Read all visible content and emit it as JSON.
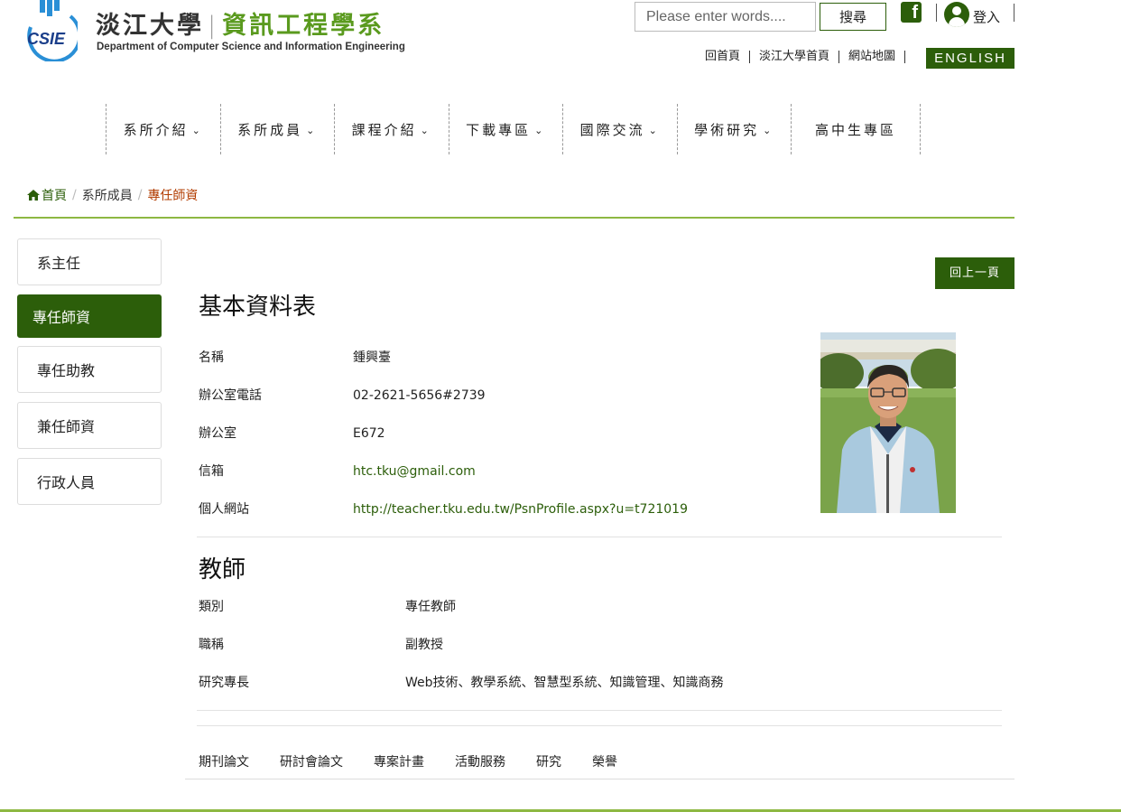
{
  "header": {
    "brand_university": "淡江大學",
    "brand_department": "資訊工程學系",
    "brand_english": "Department of Computer Science and Information Engineering",
    "logo_text": "CSIE",
    "search_placeholder": "Please enter words....",
    "search_button": "搜尋",
    "facebook_icon": "facebook-icon",
    "login_label": "登入",
    "top_links": [
      "回首頁",
      "淡江大學首頁",
      "網站地圖"
    ],
    "english_button": "ENGLISH"
  },
  "nav": {
    "items": [
      {
        "label": "系所介紹",
        "chevron": "⌄"
      },
      {
        "label": "系所成員",
        "chevron": "⌄"
      },
      {
        "label": "課程介紹",
        "chevron": "⌄"
      },
      {
        "label": "下載專區",
        "chevron": "⌄"
      },
      {
        "label": "國際交流",
        "chevron": "⌄"
      },
      {
        "label": "學術研究",
        "chevron": "⌄"
      },
      {
        "label": "高中生專區",
        "chevron": ""
      }
    ]
  },
  "breadcrumb": {
    "home": "首頁",
    "sep": "/",
    "middle": "系所成員",
    "current": "專任師資"
  },
  "sidebar": {
    "items": [
      "系主任",
      "專任師資",
      "專任助教",
      "兼任師資",
      "行政人員"
    ],
    "active_index": 1
  },
  "main": {
    "back_button": "回上一頁",
    "basic_title": "基本資料表",
    "basic_rows": [
      {
        "label": "名稱",
        "value": "鍾興臺"
      },
      {
        "label": "辦公室電話",
        "value": "02-2621-5656#2739"
      },
      {
        "label": "辦公室",
        "value": "E672"
      },
      {
        "label": "信箱",
        "value": "htc.tku@gmail.com"
      },
      {
        "label": "個人網站",
        "value": "http://teacher.tku.edu.tw/PsnProfile.aspx?u=t721019"
      }
    ],
    "teacher_title": "教師",
    "teacher_rows": [
      {
        "label": "類別",
        "value": "專任教師"
      },
      {
        "label": "職稱",
        "value": "副教授"
      },
      {
        "label": "研究專長",
        "value": "Web技術、教學系統、智慧型系統、知識管理、知識商務"
      }
    ],
    "tabs": [
      "期刊論文",
      "研討會論文",
      "專案計畫",
      "活動服務",
      "研究",
      "榮譽"
    ]
  },
  "colors": {
    "brand_green": "#2c5e0a",
    "accent_lime": "#8db842",
    "breadcrumb_current": "#b23c00"
  }
}
